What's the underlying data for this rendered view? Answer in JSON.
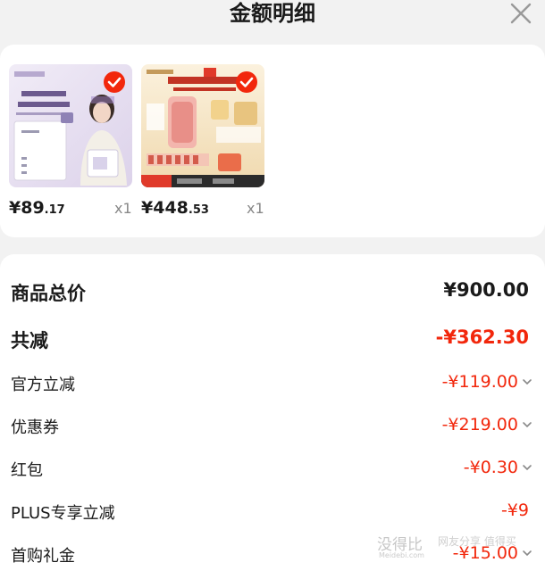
{
  "header": {
    "title": "金额明细"
  },
  "products": [
    {
      "price_int": "¥89",
      "price_dec": ".17",
      "qty": "x1",
      "selected": true
    },
    {
      "price_int": "¥448",
      "price_dec": ".53",
      "qty": "x1",
      "selected": true
    }
  ],
  "summary": {
    "total": {
      "label": "商品总价",
      "amount": "¥900.00"
    },
    "reduce": {
      "label": "共减",
      "amount": "-¥362.30"
    },
    "items": [
      {
        "label": "官方立减",
        "amount": "-¥119.00"
      },
      {
        "label": "优惠券",
        "amount": "-¥219.00"
      },
      {
        "label": "红包",
        "amount": "-¥0.30"
      },
      {
        "label": "PLUS专享立减",
        "amount": "-¥9"
      },
      {
        "label": "首购礼金",
        "amount": "-¥15.00"
      }
    ]
  },
  "watermark": {
    "logo": "没得比",
    "site": "Meidebi.com",
    "caption": "网友分享 值得买"
  },
  "colors": {
    "accent": "#f2270c",
    "background": "#f2f2f2",
    "card": "#ffffff"
  },
  "icons": {
    "close": "close-icon",
    "check": "check-icon",
    "chevron": "chevron-down-icon"
  }
}
